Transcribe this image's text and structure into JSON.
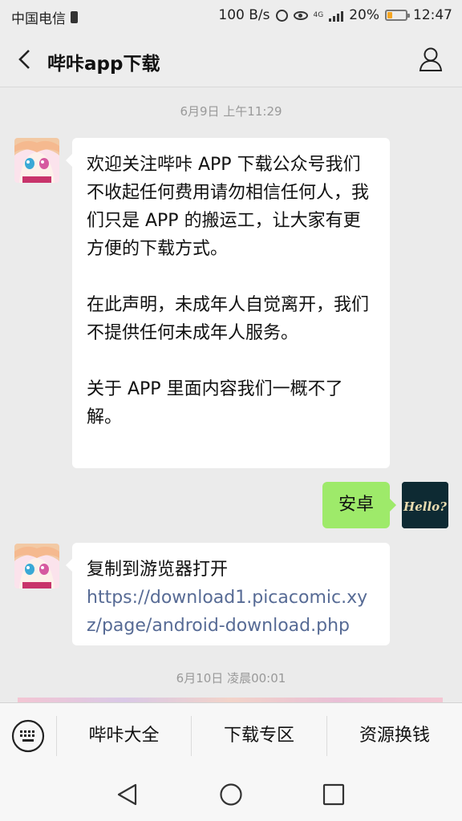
{
  "status_bar": {
    "carrier": "中国电信",
    "net_speed": "100 B/s",
    "network_type": "4G",
    "battery": "20%",
    "time": "12:47"
  },
  "header": {
    "title": "哔咔app下载"
  },
  "messages": {
    "timestamp1": "6月9日 上午11:29",
    "msg1_paragraphs": [
      "欢迎关注哔咔 APP 下载公众号我们不收起任何费用请勿相信任何人，我们只是 APP 的搬运工，让大家有更方便的下载方式。",
      "在此声明，未成年人自觉离开，我们不提供任何未成年人服务。",
      "关于 APP 里面内容我们一概不了解。"
    ],
    "reply": "安卓",
    "reply_avatar_text": "Hello?",
    "msg2_text": "复制到游览器打开",
    "msg2_link": "https://download1.picacomic.xyz/page/android-download.php",
    "timestamp2": "6月10日 凌晨00:01"
  },
  "menu": {
    "items": [
      "哔咔大全",
      "下载专区",
      "资源换钱"
    ]
  },
  "icons": {
    "back": "chevron-left-icon",
    "profile": "person-icon",
    "keyboard": "keyboard-icon",
    "nav_back": "triangle-back-icon",
    "nav_home": "circle-home-icon",
    "nav_recent": "square-recent-icon"
  },
  "colors": {
    "chat_background": "#ebebeb",
    "outgoing_bubble": "#9eea6a",
    "link": "#576b95",
    "battery_level": "#f5a623"
  }
}
